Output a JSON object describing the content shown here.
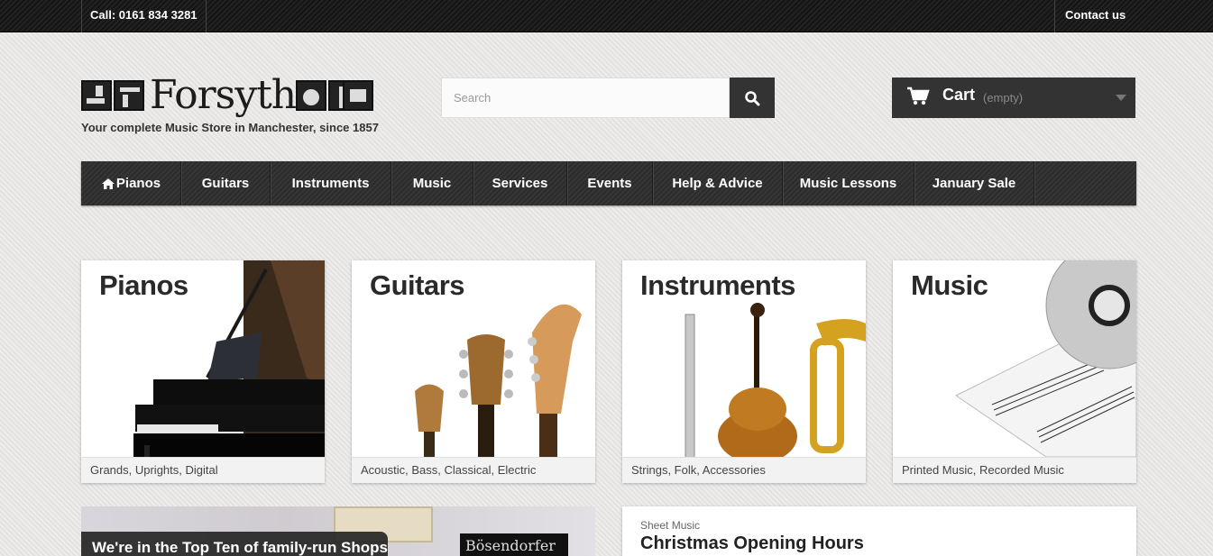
{
  "topbar": {
    "phone": "Call: 0161 834 3281",
    "contact": "Contact us"
  },
  "header": {
    "logo_text": "Forsyth",
    "tagline": "Your complete Music Store in Manchester, since 1857",
    "search_placeholder": "Search",
    "cart_label": "Cart",
    "cart_status": "(empty)"
  },
  "nav": {
    "items": [
      {
        "label": "Pianos",
        "icon": "home-icon"
      },
      {
        "label": "Guitars"
      },
      {
        "label": "Instruments"
      },
      {
        "label": "Music"
      },
      {
        "label": "Services"
      },
      {
        "label": "Events"
      },
      {
        "label": "Help & Advice"
      },
      {
        "label": "Music Lessons"
      },
      {
        "label": "January Sale"
      }
    ]
  },
  "categories": [
    {
      "title": "Pianos",
      "caption": "Grands, Uprights, Digital"
    },
    {
      "title": "Guitars",
      "caption": "Acoustic, Bass, Classical, Electric"
    },
    {
      "title": "Instruments",
      "caption": "Strings, Folk, Accessories"
    },
    {
      "title": "Music",
      "caption": "Printed Music, Recorded Music"
    }
  ],
  "promo": {
    "banner": "We're in the Top Ten of family-run Shops",
    "sign_text": "Bösendorfer"
  },
  "news": {
    "category": "Sheet Music",
    "headline": "Christmas Opening Hours"
  },
  "colors": {
    "dark_panel": "#333333",
    "page_bg": "#e9e7e4",
    "topbar_bg": "#1b1b1b"
  }
}
